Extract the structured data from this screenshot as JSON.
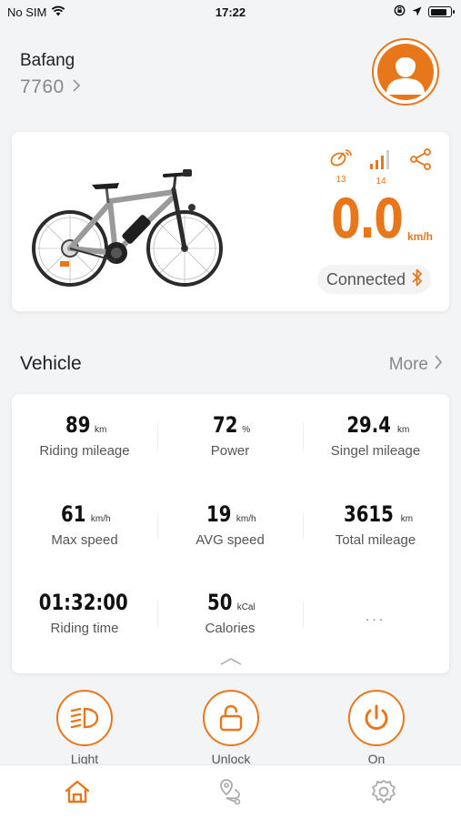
{
  "status_bar": {
    "carrier": "No SIM",
    "time": "17:22",
    "icons": [
      "wifi-icon",
      "orientation-lock-icon",
      "location-arrow-icon",
      "battery-icon"
    ],
    "battery_level": 0.85
  },
  "header": {
    "brand": "Bafang",
    "bike_id": "7760",
    "avatar_icon": "user-avatar-icon"
  },
  "bike_card": {
    "image_icon": "e-bike-image",
    "satellites": "13",
    "signal": "14",
    "speed": "0.0",
    "speed_unit": "km/h",
    "connection_status": "Connected",
    "connection_icon": "bluetooth-icon"
  },
  "vehicle": {
    "title": "Vehicle",
    "more_label": "More",
    "stats": [
      {
        "value": "89",
        "unit": "km",
        "label": "Riding mileage"
      },
      {
        "value": "72",
        "unit": "%",
        "label": "Power"
      },
      {
        "value": "29.4",
        "unit": "km",
        "label": "Singel mileage"
      },
      {
        "value": "61",
        "unit": "km/h",
        "label": "Max speed"
      },
      {
        "value": "19",
        "unit": "km/h",
        "label": "AVG speed"
      },
      {
        "value": "3615",
        "unit": "km",
        "label": "Total mileage"
      },
      {
        "value": "01:32:00",
        "unit": "",
        "label": "Riding time"
      },
      {
        "value": "50",
        "unit": "kCal",
        "label": "Calories"
      }
    ],
    "more_stats_placeholder": "..."
  },
  "actions": [
    {
      "label": "Light",
      "icon": "headlight-icon"
    },
    {
      "label": "Unlock",
      "icon": "unlock-icon"
    },
    {
      "label": "On",
      "icon": "power-icon"
    }
  ],
  "bottom_nav": [
    {
      "icon": "home-icon",
      "active": true
    },
    {
      "icon": "map-route-icon",
      "active": false
    },
    {
      "icon": "settings-gear-icon",
      "active": false
    }
  ],
  "colors": {
    "accent": "#e8771c",
    "background": "#f3f4f6",
    "card": "#ffffff",
    "text_primary": "#222222",
    "text_secondary": "#888888"
  }
}
